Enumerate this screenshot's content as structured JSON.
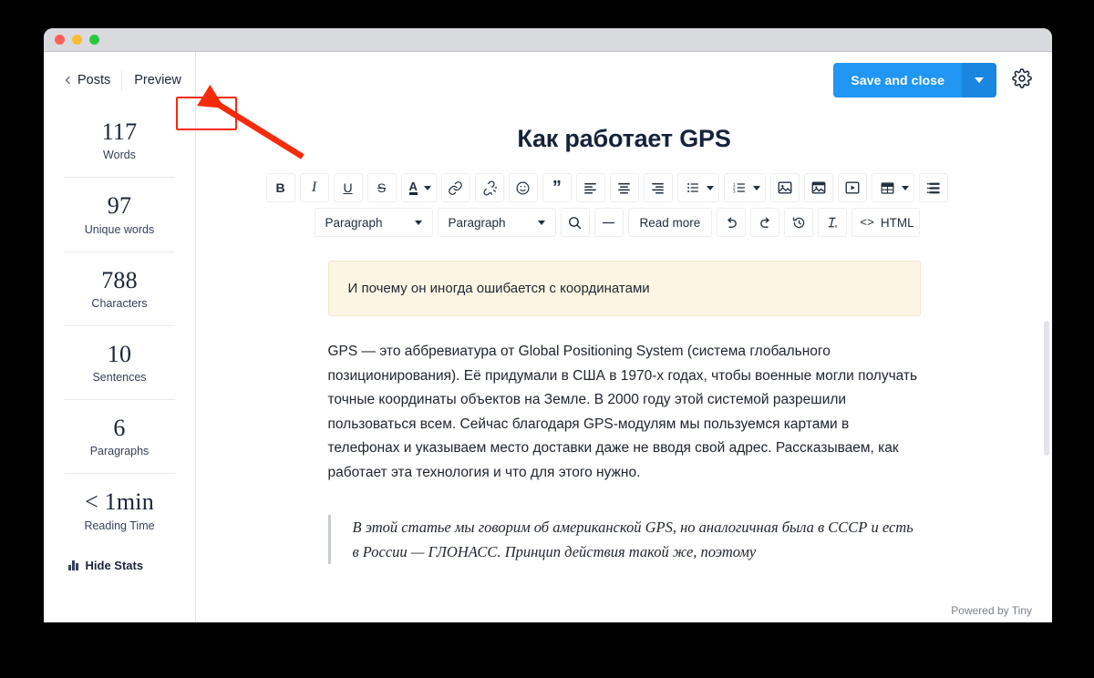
{
  "window": {
    "traffic_lights": [
      "close",
      "minimize",
      "zoom"
    ]
  },
  "sidebar": {
    "back_label": "Posts",
    "preview_label": "Preview",
    "stats": [
      {
        "value": "117",
        "label": "Words"
      },
      {
        "value": "97",
        "label": "Unique words"
      },
      {
        "value": "788",
        "label": "Characters"
      },
      {
        "value": "10",
        "label": "Sentences"
      },
      {
        "value": "6",
        "label": "Paragraphs"
      },
      {
        "value": "< 1min",
        "label": "Reading Time"
      }
    ],
    "hide_stats_label": "Hide Stats"
  },
  "header": {
    "save_label": "Save and close",
    "save_caret": "chevron-down-icon",
    "settings_icon": "gear-icon",
    "accent_color": "#2196f3",
    "accent_dark": "#1b86e0"
  },
  "editor": {
    "doc_title": "Как работает GPS",
    "toolbar_row1": [
      {
        "name": "bold-button",
        "label": "B",
        "kind": "bold"
      },
      {
        "name": "italic-button",
        "label": "I",
        "kind": "italic"
      },
      {
        "name": "underline-button",
        "label": "U",
        "kind": "underline"
      },
      {
        "name": "strikethrough-button",
        "label": "S",
        "kind": "strike"
      },
      {
        "name": "text-color-button",
        "label": "A",
        "kind": "color-split"
      },
      {
        "name": "link-button",
        "label": "",
        "kind": "link"
      },
      {
        "name": "unlink-button",
        "label": "",
        "kind": "unlink"
      },
      {
        "name": "emoji-button",
        "label": "",
        "kind": "emoji"
      },
      {
        "name": "blockquote-button",
        "label": "",
        "kind": "quote"
      },
      {
        "name": "align-left-button",
        "label": "",
        "kind": "align-left"
      },
      {
        "name": "align-center-button",
        "label": "",
        "kind": "align-center"
      },
      {
        "name": "align-right-button",
        "label": "",
        "kind": "align-right"
      },
      {
        "name": "bullet-list-button",
        "label": "",
        "kind": "ul-split"
      },
      {
        "name": "numbered-list-button",
        "label": "",
        "kind": "ol-split"
      },
      {
        "name": "insert-image-button",
        "label": "",
        "kind": "image"
      },
      {
        "name": "insert-image-caption-button",
        "label": "",
        "kind": "image-caption"
      },
      {
        "name": "insert-video-button",
        "label": "",
        "kind": "video"
      },
      {
        "name": "insert-table-button",
        "label": "",
        "kind": "table-split"
      },
      {
        "name": "table-of-contents-button",
        "label": "",
        "kind": "toc"
      }
    ],
    "toolbar_row2": [
      {
        "name": "block-format-select",
        "label": "Paragraph",
        "kind": "select"
      },
      {
        "name": "paragraph-style-select",
        "label": "Paragraph",
        "kind": "select"
      },
      {
        "name": "search-replace-button",
        "label": "",
        "kind": "search"
      },
      {
        "name": "horizontal-rule-button",
        "label": "",
        "kind": "hr"
      },
      {
        "name": "read-more-button",
        "label": "Read more",
        "kind": "text"
      },
      {
        "name": "undo-button",
        "label": "",
        "kind": "undo"
      },
      {
        "name": "redo-button",
        "label": "",
        "kind": "redo"
      },
      {
        "name": "revision-history-button",
        "label": "",
        "kind": "history"
      },
      {
        "name": "clear-formatting-button",
        "label": "",
        "kind": "clearfmt"
      },
      {
        "name": "source-code-button",
        "label": "HTML",
        "kind": "html"
      }
    ],
    "callout_text": "И почему он иногда ошибается с координатами",
    "paragraph_1": "GPS — это аббревиатура от Global Positioning System (система глобального позиционирования). Её придумали в США в 1970-х годах, чтобы военные могли получать точные координаты объектов на Земле. В 2000 году этой системой разрешили пользоваться всем. Сейчас благодаря GPS-модулям мы пользуемся картами в телефонах и указываем место доставки даже не вводя свой адрес. Рассказываем, как работает эта технология и что для этого нужно.",
    "blockquote_text": "В этой статье мы говорим об американской GPS, но аналогичная была в СССР и есть в России — ГЛОНАСС. Принцип действия такой же, поэтому",
    "powered_by": "Powered by Tiny"
  },
  "annotation": {
    "highlight_target": "preview-button",
    "highlight_color": "#f62b0a",
    "arrow_color": "#f62b0a"
  }
}
